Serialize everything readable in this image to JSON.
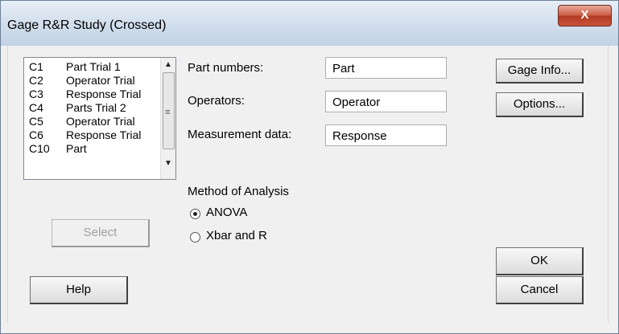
{
  "window": {
    "title": "Gage R&R Study (Crossed)",
    "close_label": "X"
  },
  "columns": [
    {
      "code": "C1",
      "name": "Part Trial 1"
    },
    {
      "code": "C2",
      "name": "Operator Trial"
    },
    {
      "code": "C3",
      "name": "Response Trial"
    },
    {
      "code": "C4",
      "name": "Parts Trial 2"
    },
    {
      "code": "C5",
      "name": "Operator Trial"
    },
    {
      "code": "C6",
      "name": "Response Trial"
    },
    {
      "code": "C10",
      "name": "Part"
    }
  ],
  "scrollbar": {
    "grip": "≡",
    "up": "▲",
    "down": "▼"
  },
  "fields": {
    "part_label": "Part numbers:",
    "part_value": "Part",
    "operators_label": "Operators:",
    "operators_value": "Operator",
    "measurement_label": "Measurement data:",
    "measurement_value": "Response"
  },
  "method": {
    "heading": "Method of Analysis",
    "options": [
      "ANOVA",
      "Xbar and R"
    ],
    "selected": "ANOVA"
  },
  "buttons": {
    "gage_info": "Gage Info...",
    "options": "Options...",
    "select": "Select",
    "help": "Help",
    "ok": "OK",
    "cancel": "Cancel"
  }
}
